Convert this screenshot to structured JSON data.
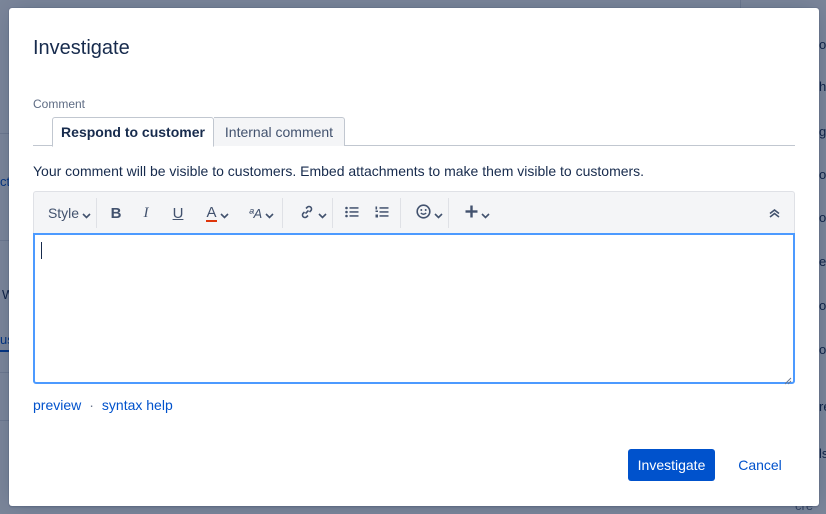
{
  "background": {
    "fragments": [
      "ct",
      "W",
      "us",
      "on",
      "he",
      "gr",
      "on",
      "el",
      "on",
      "oo",
      "re",
      "ls",
      "cre"
    ]
  },
  "modal": {
    "title": "Investigate",
    "comment_label": "Comment",
    "tabs": [
      {
        "label": "Respond to customer",
        "active": true
      },
      {
        "label": "Internal comment",
        "active": false
      }
    ],
    "visibility_note": "Your comment will be visible to customers. Embed attachments to make them visible to customers.",
    "toolbar": {
      "style_label": "Style",
      "bold_label": "B",
      "italic_label": "I",
      "underline_label": "U",
      "text_color_label": "A",
      "text_color_accent": "#de350b",
      "more_formatting_label": "ªA",
      "icons": [
        "link-icon",
        "bullet-list-icon",
        "numbered-list-icon",
        "emoji-icon",
        "insert-icon",
        "collapse-icon"
      ]
    },
    "editor": {
      "value": ""
    },
    "links": {
      "preview": "preview",
      "separator": "·",
      "syntax_help": "syntax help"
    },
    "actions": {
      "primary_label": "Investigate",
      "cancel_label": "Cancel"
    }
  },
  "colors": {
    "accent": "#0052cc",
    "focus_border": "#4c9aff",
    "overlay": "#8a93a3"
  }
}
